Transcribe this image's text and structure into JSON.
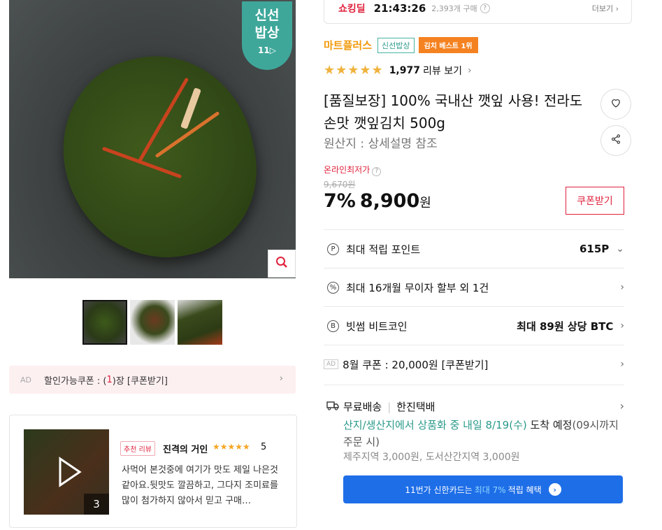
{
  "image": {
    "badge_line1": "신선",
    "badge_line2": "밥상",
    "badge_logo": "11▷",
    "thumb_count": 3
  },
  "ad_coupon": {
    "ad_label": "AD",
    "text_before": "할인가능쿠폰 : (",
    "count": "1",
    "text_after": ")장 [쿠폰받기]"
  },
  "review": {
    "tag": "추천 리뷰",
    "reviewer": "진격의 거인",
    "stars": "★★★★★",
    "score": "5",
    "image_count": "3",
    "text": "사먹어 본것중에 여기가 맛도 제일 나은것 같아요.뒷맛도 깔끔하고, 그다지 조미료를 많이 첨가하지 않아서 믿고 구매…"
  },
  "shocking_deal": {
    "logo": "쇼킹딜",
    "time": "21:43:26",
    "buy_count": "2,393개 구매",
    "help": "?",
    "more": "더보기 ›"
  },
  "store": {
    "name": "마트플러스",
    "tag_fresh": "신선밥상",
    "tag_best": "김치 베스트 1위"
  },
  "rating": {
    "stars": "★★★★★",
    "count": "1,977",
    "link": "리뷰 보기",
    "value": 4.5
  },
  "product": {
    "title": "[품질보장] 100% 국내산 깻잎 사용! 전라도 손맛 깻잎김치 500g",
    "origin": "원산지 : 상세설명 참조"
  },
  "price": {
    "lowest_label": "온라인최저가",
    "original": "9,670원",
    "discount": "7%",
    "amount": "8,900",
    "unit": "원",
    "coupon_button": "쿠폰받기"
  },
  "benefits": [
    {
      "icon": "P",
      "label": "최대 적립 포인트",
      "value": "615P",
      "arrow": "⌄"
    },
    {
      "icon": "%",
      "label": "최대 16개월 무이자 할부 외 1건",
      "value": "",
      "arrow": "›"
    },
    {
      "icon": "B",
      "label": "빗썸 비트코인",
      "value": "최대 89원 상당 BTC",
      "arrow": "›"
    },
    {
      "icon": "AD",
      "label": "8월 쿠폰 : 20,000원 [쿠폰받기]",
      "value": "",
      "arrow": "›"
    }
  ],
  "delivery": {
    "method": "무료배송",
    "carrier": "한진택배",
    "eta_teal": "산지/생산지에서 상품화 중 내일 8/19(수)",
    "eta_rest": " 도착 예정",
    "eta_note": "(09시까지 주문 시)",
    "extra": "제주지역 3,000원, 도서산간지역 3,000원"
  },
  "card_banner": {
    "before": "11번가 신한카드는",
    "highlight": "최대 7%",
    "after": "적립 혜택"
  },
  "colors": {
    "accent_red": "#e0223d",
    "teal": "#2a9a8a",
    "orange": "#f58220",
    "blue": "#1e6ee8"
  }
}
